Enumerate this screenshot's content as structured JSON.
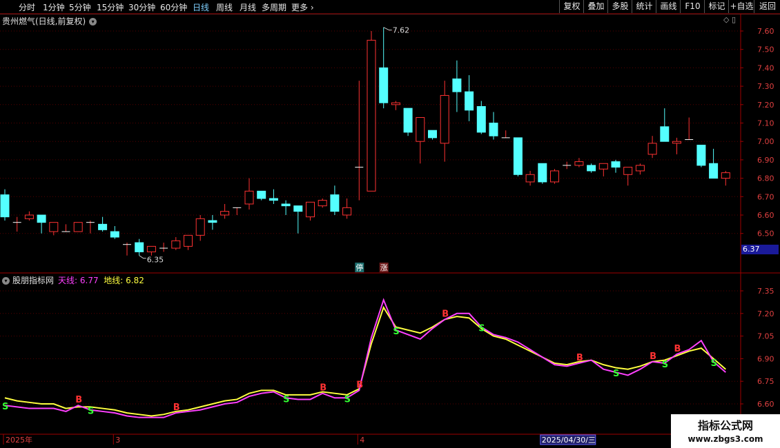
{
  "toolbar": {
    "periods": [
      "分时",
      "1分钟",
      "5分钟",
      "15分钟",
      "30分钟",
      "60分钟",
      "日线",
      "周线",
      "月线",
      "多周期",
      "更多"
    ],
    "active_period": "日线",
    "right_buttons": [
      "复权",
      "叠加",
      "多股",
      "统计",
      "画线",
      "F10",
      "标记",
      "+自选",
      "返回"
    ]
  },
  "stock_title": "贵州燃气(日线,前复权)",
  "indicator": {
    "name": "股朋指标网",
    "tian_label": "天线:",
    "tian_value": "6.77",
    "di_label": "地线:",
    "di_value": "6.82"
  },
  "current_price_tag": "6.37",
  "watermark": {
    "line1": "指标公式网",
    "line2": "www.zbgs3.com"
  },
  "colors": {
    "up": "#ff3232",
    "down": "#54ffff",
    "tian": "#ff40ff",
    "di": "#ffff40",
    "buy": "#ff3232",
    "sell": "#33ff33",
    "axis": "#a00000"
  },
  "chart_data": [
    {
      "type": "candlestick",
      "title": "贵州燃气(日线,前复权)",
      "ylim": [
        6.37,
        7.68
      ],
      "y_ticks": [
        "7.60",
        "7.50",
        "7.40",
        "7.30",
        "7.20",
        "7.10",
        "7.00",
        "6.90",
        "6.80",
        "6.70",
        "6.60",
        "6.50"
      ],
      "annotations": [
        {
          "text": "7.62",
          "type": "high"
        },
        {
          "text": "6.35",
          "type": "low"
        },
        {
          "text": "停",
          "bar": 29
        },
        {
          "text": "涨",
          "bar": 31
        }
      ],
      "candles": [
        [
          6.71,
          6.74,
          6.57,
          6.59
        ],
        [
          6.56,
          6.59,
          6.51,
          6.56
        ],
        [
          6.58,
          6.62,
          6.57,
          6.6
        ],
        [
          6.6,
          6.6,
          6.5,
          6.56
        ],
        [
          6.51,
          6.56,
          6.49,
          6.56
        ],
        [
          6.51,
          6.55,
          6.51,
          6.51
        ],
        [
          6.51,
          6.56,
          6.51,
          6.56
        ],
        [
          6.56,
          6.57,
          6.5,
          6.56
        ],
        [
          6.55,
          6.59,
          6.51,
          6.52
        ],
        [
          6.51,
          6.54,
          6.47,
          6.48
        ],
        [
          6.44,
          6.45,
          6.38,
          6.44
        ],
        [
          6.45,
          6.47,
          6.38,
          6.4
        ],
        [
          6.4,
          6.43,
          6.38,
          6.43
        ],
        [
          6.42,
          6.45,
          6.4,
          6.42
        ],
        [
          6.42,
          6.48,
          6.41,
          6.46
        ],
        [
          6.43,
          6.48,
          6.41,
          6.49
        ],
        [
          6.49,
          6.6,
          6.46,
          6.58
        ],
        [
          6.57,
          6.6,
          6.52,
          6.56
        ],
        [
          6.6,
          6.66,
          6.58,
          6.62
        ],
        [
          6.64,
          6.64,
          6.6,
          6.64
        ],
        [
          6.66,
          6.8,
          6.63,
          6.73
        ],
        [
          6.73,
          6.73,
          6.68,
          6.69
        ],
        [
          6.69,
          6.74,
          6.66,
          6.68
        ],
        [
          6.66,
          6.68,
          6.6,
          6.65
        ],
        [
          6.65,
          6.65,
          6.5,
          6.62
        ],
        [
          6.59,
          6.66,
          6.57,
          6.67
        ],
        [
          6.65,
          6.69,
          6.64,
          6.68
        ],
        [
          6.71,
          6.76,
          6.6,
          6.62
        ],
        [
          6.6,
          6.69,
          6.58,
          6.64
        ],
        [
          6.86,
          7.33,
          6.68,
          6.86
        ],
        [
          6.73,
          7.6,
          6.73,
          7.55
        ],
        [
          7.4,
          7.62,
          7.18,
          7.21
        ],
        [
          7.2,
          7.22,
          7.17,
          7.21
        ],
        [
          7.18,
          7.18,
          7.03,
          7.05
        ],
        [
          7.0,
          7.13,
          6.88,
          7.13
        ],
        [
          7.06,
          7.06,
          7.01,
          7.02
        ],
        [
          6.99,
          7.33,
          6.89,
          7.25
        ],
        [
          7.34,
          7.44,
          7.16,
          7.27
        ],
        [
          7.27,
          7.36,
          7.11,
          7.17
        ],
        [
          7.19,
          7.22,
          7.04,
          7.05
        ],
        [
          7.1,
          7.16,
          7.01,
          7.03
        ],
        [
          7.02,
          7.06,
          7.02,
          7.02
        ],
        [
          7.02,
          7.02,
          6.81,
          6.82
        ],
        [
          6.78,
          6.84,
          6.76,
          6.82
        ],
        [
          6.88,
          6.88,
          6.77,
          6.78
        ],
        [
          6.78,
          6.85,
          6.77,
          6.84
        ],
        [
          6.87,
          6.89,
          6.85,
          6.87
        ],
        [
          6.87,
          6.91,
          6.86,
          6.89
        ],
        [
          6.87,
          6.88,
          6.83,
          6.84
        ],
        [
          6.85,
          6.88,
          6.81,
          6.88
        ],
        [
          6.89,
          6.9,
          6.83,
          6.86
        ],
        [
          6.82,
          6.86,
          6.76,
          6.86
        ],
        [
          6.84,
          6.88,
          6.82,
          6.87
        ],
        [
          6.93,
          7.03,
          6.91,
          6.99
        ],
        [
          7.08,
          7.18,
          7.02,
          7.0
        ],
        [
          6.99,
          7.02,
          6.93,
          7.0
        ],
        [
          7.01,
          7.13,
          7.01,
          7.01
        ],
        [
          6.98,
          6.98,
          6.86,
          6.87
        ],
        [
          6.88,
          6.96,
          6.81,
          6.8
        ],
        [
          6.8,
          6.84,
          6.76,
          6.83
        ]
      ]
    },
    {
      "type": "line",
      "title": "股朋指标网",
      "ylim": [
        6.52,
        7.4
      ],
      "y_ticks": [
        "7.35",
        "7.20",
        "7.05",
        "6.90",
        "6.75",
        "6.60"
      ],
      "series": [
        {
          "name": "天线",
          "values": [
            6.59,
            6.58,
            6.57,
            6.57,
            6.57,
            6.55,
            6.59,
            6.56,
            6.55,
            6.54,
            6.52,
            6.51,
            6.51,
            6.51,
            6.54,
            6.55,
            6.56,
            6.58,
            6.6,
            6.61,
            6.65,
            6.67,
            6.68,
            6.64,
            6.63,
            6.63,
            6.67,
            6.64,
            6.64,
            6.69,
            7.04,
            7.29,
            7.09,
            7.06,
            7.03,
            7.1,
            7.16,
            7.2,
            7.2,
            7.11,
            7.06,
            7.04,
            7.01,
            6.96,
            6.91,
            6.86,
            6.85,
            6.87,
            6.89,
            6.83,
            6.81,
            6.79,
            6.83,
            6.88,
            6.87,
            6.93,
            6.96,
            7.02,
            6.88,
            6.81
          ]
        },
        {
          "name": "地线",
          "values": [
            6.64,
            6.62,
            6.61,
            6.6,
            6.6,
            6.57,
            6.58,
            6.58,
            6.57,
            6.56,
            6.54,
            6.53,
            6.52,
            6.53,
            6.55,
            6.56,
            6.58,
            6.6,
            6.62,
            6.63,
            6.67,
            6.69,
            6.69,
            6.66,
            6.66,
            6.66,
            6.68,
            6.67,
            6.66,
            6.7,
            7.0,
            7.24,
            7.11,
            7.09,
            7.07,
            7.11,
            7.16,
            7.18,
            7.17,
            7.1,
            7.05,
            7.03,
            6.99,
            6.95,
            6.91,
            6.87,
            6.86,
            6.88,
            6.89,
            6.86,
            6.84,
            6.83,
            6.85,
            6.88,
            6.89,
            6.92,
            6.95,
            6.97,
            6.9,
            6.83
          ]
        }
      ],
      "signals": [
        {
          "bar": 0,
          "text": "S"
        },
        {
          "bar": 6,
          "text": "B"
        },
        {
          "bar": 7,
          "text": "S"
        },
        {
          "bar": 14,
          "text": "B"
        },
        {
          "bar": 23,
          "text": "S"
        },
        {
          "bar": 26,
          "text": "B"
        },
        {
          "bar": 28,
          "text": "S"
        },
        {
          "bar": 29,
          "text": "B"
        },
        {
          "bar": 32,
          "text": "S"
        },
        {
          "bar": 36,
          "text": "B"
        },
        {
          "bar": 39,
          "text": "S"
        },
        {
          "bar": 47,
          "text": "B"
        },
        {
          "bar": 50,
          "text": "S"
        },
        {
          "bar": 53,
          "text": "B"
        },
        {
          "bar": 54,
          "text": "S"
        },
        {
          "bar": 55,
          "text": "B"
        },
        {
          "bar": 58,
          "text": "S"
        }
      ],
      "x_labels": [
        {
          "bar": 0,
          "text": "2025年"
        },
        {
          "bar": 9,
          "text": "3"
        },
        {
          "bar": 29,
          "text": "4"
        },
        {
          "bar": 44,
          "text": "2025/04/30/三",
          "highlight": true
        }
      ]
    }
  ]
}
